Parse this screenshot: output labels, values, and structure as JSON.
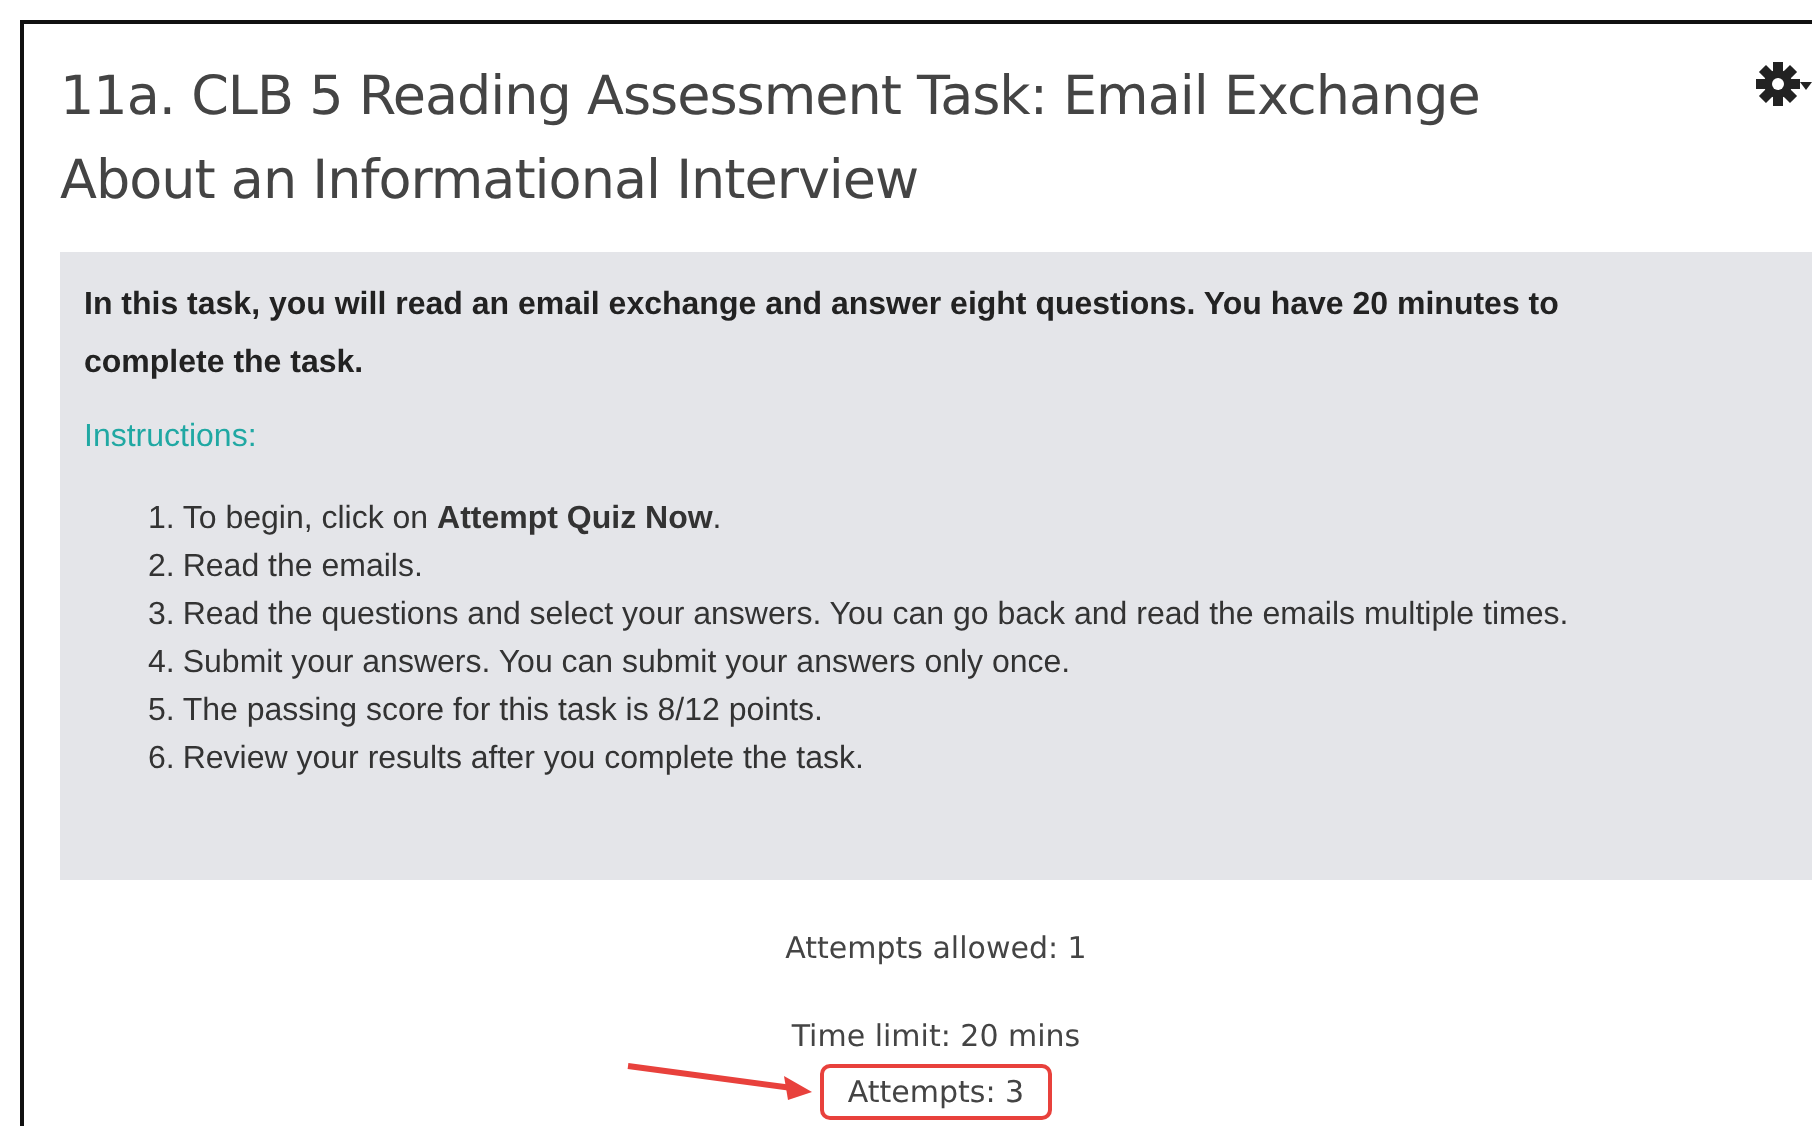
{
  "title": "11a. CLB 5 Reading Assessment Task: Email Exchange About an Informational Interview",
  "intro": "In this task, you will read an email exchange and answer eight questions. You have 20 minutes to complete the task.",
  "instructions_heading": "Instructions:",
  "steps": [
    {
      "number": "1.",
      "text": "To begin, click on **Attempt Quiz Now**."
    },
    {
      "number": "2.",
      "text": "Read the emails."
    },
    {
      "number": "3.",
      "text": "Read the questions and select your answers. You can go back and read the emails multiple times."
    },
    {
      "number": "4.",
      "text": "Submit your answers. You can submit your answers only once."
    },
    {
      "number": "5.",
      "text": "The passing score for this task is 8/12 points."
    },
    {
      "number": "6.",
      "text": "Review your results after you complete the task."
    }
  ],
  "quiz_info": [
    {
      "text": "Attempts allowed: 1",
      "highlighted": false
    },
    {
      "text": "Time limit: 20 mins",
      "highlighted": false
    },
    {
      "text": "Attempts: 3",
      "highlighted": true
    }
  ]
}
